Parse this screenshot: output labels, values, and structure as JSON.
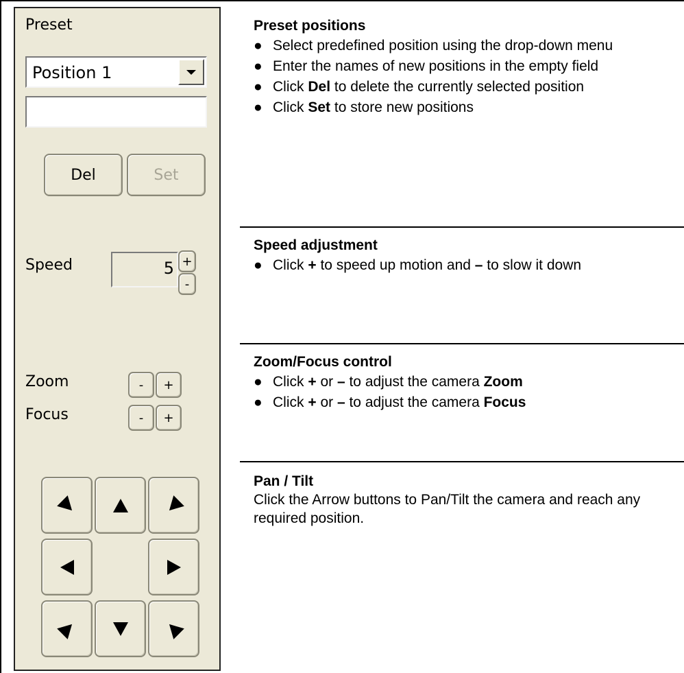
{
  "panel": {
    "preset_label": "Preset",
    "position_select": {
      "selected": "Position 1"
    },
    "name_field": {
      "value": ""
    },
    "del_label": "Del",
    "set_label": "Set",
    "speed_label": "Speed",
    "speed_value": "5",
    "speed_plus": "+",
    "speed_minus": "-",
    "zoom_label": "Zoom",
    "focus_label": "Focus",
    "minus": "-",
    "plus": "+"
  },
  "sections": {
    "preset": {
      "title": "Preset positions",
      "b1": "Select predefined position using the drop-down menu",
      "b2": "Enter the names of new positions in the empty field",
      "b3_pre": "Click ",
      "b3_bold": "Del",
      "b3_post": " to delete the currently selected position",
      "b4_pre": "Click ",
      "b4_bold": "Set",
      "b4_post": " to store new positions"
    },
    "speed": {
      "title": "Speed adjustment",
      "b1_pre": "Click ",
      "b1_plus": "+",
      "b1_mid": " to speed up motion and ",
      "b1_minus": "–",
      "b1_post": " to slow it down"
    },
    "zoomfocus": {
      "title": "Zoom/Focus control",
      "b1_pre": "Click ",
      "b1_plus": "+",
      "b1_or": " or ",
      "b1_minus": "–",
      "b1_mid": " to adjust the camera ",
      "b1_bold": "Zoom",
      "b2_pre": "Click ",
      "b2_plus": "+",
      "b2_or": " or ",
      "b2_minus": "–",
      "b2_mid": " to adjust the camera ",
      "b2_bold": "Focus"
    },
    "pantilt": {
      "title": "Pan / Tilt",
      "text": "Click the Arrow buttons to Pan/Tilt the camera and reach any required position."
    }
  },
  "bullet_char": "●",
  "icons": [
    "dropdown-arrow-icon",
    "arrow-up-icon",
    "arrow-down-icon",
    "arrow-left-icon",
    "arrow-right-icon",
    "arrow-up-left-icon",
    "arrow-up-right-icon",
    "arrow-down-left-icon",
    "arrow-down-right-icon"
  ]
}
